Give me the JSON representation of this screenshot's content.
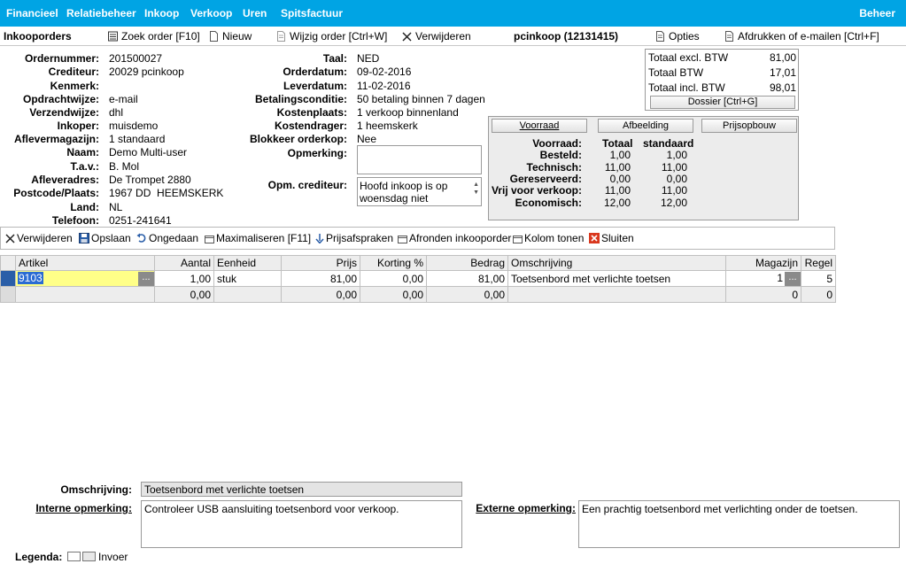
{
  "nav": {
    "items": [
      "Financieel",
      "Relatiebeheer",
      "Inkoop",
      "Verkoop",
      "Uren",
      "Spitsfactuur"
    ],
    "right": "Beheer",
    "bg_color": "#00a4e4"
  },
  "toolbar": {
    "page_title": "Inkooporders",
    "find_order": "Zoek order [F10]",
    "new": "Nieuw",
    "edit_order": "Wijzig order [Ctrl+W]",
    "delete": "Verwijderen",
    "record_title": "pcinkoop (12131415)",
    "options": "Opties",
    "print_email": "Afdrukken of e-mailen [Ctrl+F]"
  },
  "header_left": [
    {
      "label": "Ordernummer:",
      "value": "201500027"
    },
    {
      "label": "Crediteur:",
      "value": "20029 pcinkoop"
    },
    {
      "label": "Kenmerk:",
      "value": ""
    },
    {
      "label": "Opdrachtwijze:",
      "value": "e-mail"
    },
    {
      "label": "Verzendwijze:",
      "value": "dhl"
    },
    {
      "label": "Inkoper:",
      "value": "muisdemo"
    },
    {
      "label": "Aflevermagazijn:",
      "value": "1 standaard"
    },
    {
      "label": "Naam:",
      "value": "Demo Multi-user"
    },
    {
      "label": "T.a.v.:",
      "value": "B. Mol"
    },
    {
      "label": "Afleveradres:",
      "value": "De Trompet 2880"
    },
    {
      "label": "Postcode/Plaats:",
      "value": "1967 DD  HEEMSKERK"
    },
    {
      "label": "Land:",
      "value": "NL"
    },
    {
      "label": "Telefoon:",
      "value": "0251-241641"
    }
  ],
  "header_right": [
    {
      "label": "Taal:",
      "value": "NED"
    },
    {
      "label": "Orderdatum:",
      "value": "09-02-2016"
    },
    {
      "label": "Leverdatum:",
      "value": "11-02-2016"
    },
    {
      "label": "Betalingsconditie:",
      "value": "50 betaling binnen 7 dagen"
    },
    {
      "label": "Kostenplaats:",
      "value": "1 verkoop binnenland"
    },
    {
      "label": "Kostendrager:",
      "value": "1 heemskerk"
    },
    {
      "label": "Blokkeer orderkop:",
      "value": "Nee"
    }
  ],
  "opmerking": {
    "label": "Opmerking:",
    "value": ""
  },
  "opm_crediteur": {
    "label": "Opm. crediteur:",
    "value": "Hoofd inkoop is op woensdag niet"
  },
  "totals": {
    "excl_label": "Totaal excl. BTW",
    "excl_value": "81,00",
    "btw_label": "Totaal BTW",
    "btw_value": "17,01",
    "incl_label": "Totaal incl. BTW",
    "incl_value": "98,01",
    "dossier_button": "Dossier [Ctrl+G]"
  },
  "stock": {
    "tabs": [
      "Voorraad",
      "Afbeelding",
      "Prijsopbouw"
    ],
    "header": {
      "label": "Voorraad:",
      "col1": "Totaal",
      "col2": "standaard"
    },
    "rows": [
      {
        "label": "Besteld:",
        "v1": "1,00",
        "v2": "1,00"
      },
      {
        "label": "Technisch:",
        "v1": "11,00",
        "v2": "11,00"
      },
      {
        "label": "Gereserveerd:",
        "v1": "0,00",
        "v2": "0,00"
      },
      {
        "label": "Vrij voor verkoop:",
        "v1": "11,00",
        "v2": "11,00"
      },
      {
        "label": "Economisch:",
        "v1": "12,00",
        "v2": "12,00"
      }
    ]
  },
  "linebar": {
    "delete": "Verwijderen",
    "save": "Opslaan",
    "undo": "Ongedaan",
    "maximize": "Maximaliseren [F11]",
    "price_agreements": "Prijsafspraken",
    "finish_order": "Afronden inkooporder",
    "show_column": "Kolom tonen",
    "close": "Sluiten"
  },
  "grid": {
    "columns": [
      "Artikel",
      "Aantal",
      "Eenheid",
      "Prijs",
      "Korting %",
      "Bedrag",
      "Omschrijving",
      "Magazijn",
      "Regel"
    ],
    "rows": [
      {
        "artikel": "9103",
        "aantal": "1,00",
        "eenheid": "stuk",
        "prijs": "81,00",
        "korting": "0,00",
        "bedrag": "81,00",
        "omschrijving": "Toetsenbord met verlichte toetsen",
        "magazijn": "1",
        "regel": "5"
      },
      {
        "artikel": "",
        "aantal": "0,00",
        "eenheid": "",
        "prijs": "0,00",
        "korting": "0,00",
        "bedrag": "0,00",
        "omschrijving": "",
        "magazijn": "0",
        "regel": "0"
      }
    ],
    "ellipsis": "..."
  },
  "bottom": {
    "omschrijving_label": "Omschrijving:",
    "omschrijving_value": "Toetsenbord met verlichte toetsen",
    "interne_label": "Interne opmerking:",
    "interne_value": "Controleer USB aansluiting toetsenbord voor verkoop.",
    "externe_label": "Externe opmerking:",
    "externe_value": "Een prachtig toetsenbord met verlichting onder de toetsen.",
    "legend_label": "Legenda:",
    "legend_invoer": "Invoer"
  }
}
